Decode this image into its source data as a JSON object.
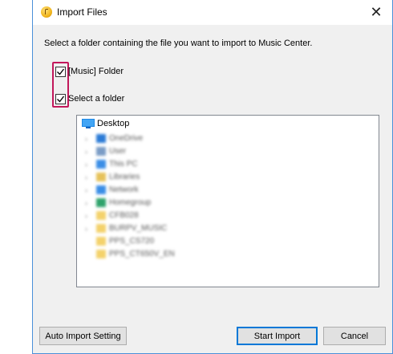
{
  "window": {
    "title": "Import Files",
    "close_glyph": "✕",
    "app_icon": "music-note-icon"
  },
  "instruction": "Select a folder containing the file you want to import to Music Center.",
  "options": [
    {
      "label": "[Music] Folder",
      "checked": true
    },
    {
      "label": "Select a folder",
      "checked": true
    }
  ],
  "tree": {
    "root_label": "Desktop",
    "items": [
      {
        "label": "OneDrive",
        "icon": "cloud-icon",
        "color": "#2b7bd6",
        "expandable": true
      },
      {
        "label": "User",
        "icon": "user-folder-icon",
        "color": "#7a9cc6",
        "expandable": true
      },
      {
        "label": "This PC",
        "icon": "computer-icon",
        "color": "#3a8ee6",
        "expandable": true
      },
      {
        "label": "Libraries",
        "icon": "library-icon",
        "color": "#e6c25a",
        "expandable": true
      },
      {
        "label": "Network",
        "icon": "network-icon",
        "color": "#3a8ee6",
        "expandable": true
      },
      {
        "label": "Homegroup",
        "icon": "homegroup-icon",
        "color": "#2fa36b",
        "expandable": true
      },
      {
        "label": "CFB028",
        "icon": "folder-icon",
        "color": "#f4d26b",
        "expandable": true
      },
      {
        "label": "BURPV_MUSIC",
        "icon": "folder-icon",
        "color": "#f4d26b",
        "expandable": true
      },
      {
        "label": "PPS_CS720",
        "icon": "folder-icon",
        "color": "#f4d26b",
        "expandable": false
      },
      {
        "label": "PPS_CT650V_EN",
        "icon": "folder-icon",
        "color": "#f4d26b",
        "expandable": false
      }
    ]
  },
  "buttons": {
    "auto_import": "Auto Import Setting",
    "start_import": "Start Import",
    "cancel": "Cancel"
  },
  "colors": {
    "highlight_border": "#c2185b",
    "accent": "#0078d7",
    "window_border": "#4a90d9"
  }
}
